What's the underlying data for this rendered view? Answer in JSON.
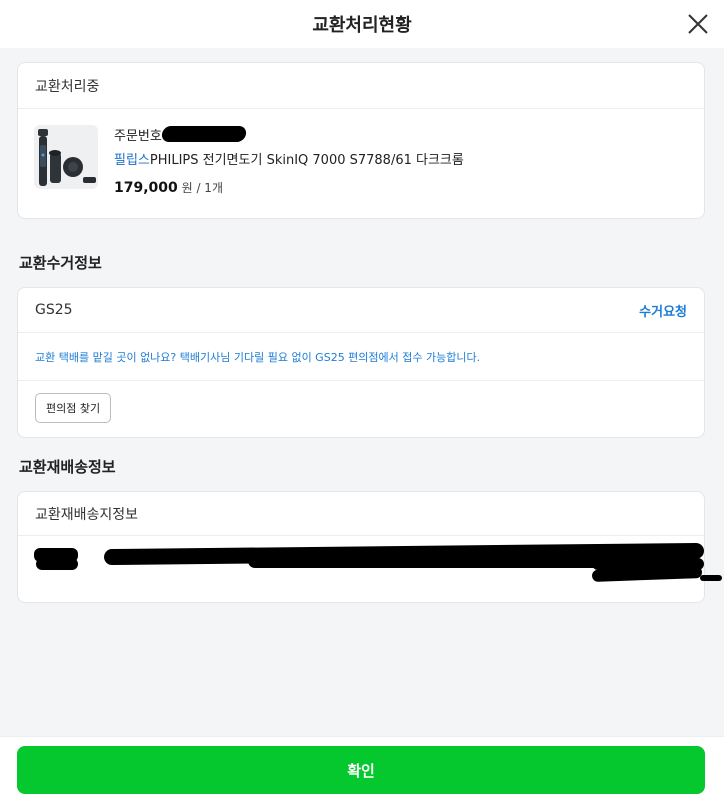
{
  "header": {
    "title": "교환처리현황",
    "close_icon": "close-icon"
  },
  "status_card": {
    "status": "교환처리중",
    "order_label": "주문번호",
    "brand": "필립스",
    "product_name": "PHILIPS 전기면도기 SkinIQ 7000 S7788/61 다크크롬",
    "price": "179,000",
    "price_suffix": "원 / 1개"
  },
  "pickup_section": {
    "title": "교환수거정보",
    "method": "GS25",
    "request_link": "수거요청",
    "notice": "교환 택배를 맡길 곳이 없나요? 택배기사님 기다릴 필요 없이 GS25 편의점에서 접수 가능합니다.",
    "find_store_button": "편의점 찾기"
  },
  "reship_section": {
    "title": "교환재배송정보",
    "address_label": "교환재배송지정보"
  },
  "footer": {
    "confirm_button": "확인"
  },
  "colors": {
    "accent_green": "#05c72e",
    "link_blue": "#1c7cd6"
  }
}
